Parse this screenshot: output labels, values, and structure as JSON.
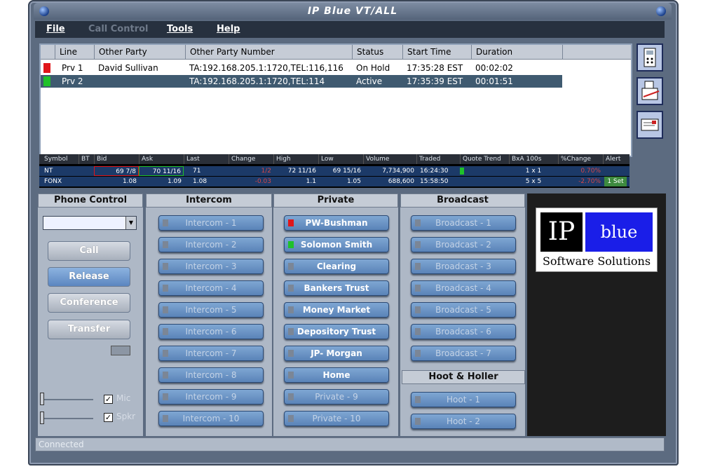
{
  "window": {
    "title": "IP Blue VT/ALL"
  },
  "menu": {
    "file": "File",
    "call_control": "Call Control",
    "tools": "Tools",
    "help": "Help"
  },
  "calls": {
    "headers": [
      "Line",
      "Other Party",
      "Other Party Number",
      "Status",
      "Start Time",
      "Duration"
    ],
    "rows": [
      {
        "line": "Prv 1",
        "party": "David Sullivan",
        "number": "TA:192.168.205.1:1720,TEL:116,116",
        "status": "On Hold",
        "start": "17:35:28 EST",
        "duration": "00:02:02",
        "indicator": "#e0161b"
      },
      {
        "line": "Prv 2",
        "party": "",
        "number": "TA:192.168.205.1:1720,TEL:114",
        "status": "Active",
        "start": "17:35:39 EST",
        "duration": "00:01:51",
        "indicator": "#1fc12a"
      }
    ]
  },
  "quotes": {
    "headers": [
      "Symbol",
      "BT",
      "Bid",
      "Ask",
      "Last",
      "Change",
      "High",
      "Low",
      "Volume",
      "Traded",
      "Quote Trend",
      "BxA 100s",
      "%Change",
      "Alert"
    ],
    "rows": [
      {
        "symbol": "NT",
        "bid": "69 7/8",
        "ask": "70 11/16",
        "last": "71",
        "change": "1/2",
        "high": "72 11/16",
        "low": "69 15/16",
        "volume": "7,734,900",
        "traded": "16:24:30",
        "bxa": "1 x 1",
        "pct": "0.70%",
        "alert": ""
      },
      {
        "symbol": "FONX",
        "bid": "1.08",
        "ask": "1.09",
        "last": "1.08",
        "change": "-0.03",
        "high": "1.1",
        "low": "1.05",
        "volume": "688,600",
        "traded": "15:58:50",
        "bxa": "5 x 5",
        "pct": "-2.70%",
        "alert": "1 Set"
      }
    ]
  },
  "phone_control": {
    "title": "Phone Control",
    "call": "Call",
    "release": "Release",
    "conference": "Conference",
    "transfer": "Transfer",
    "mic": "Mic",
    "spkr": "Spkr"
  },
  "intercom": {
    "title": "Intercom",
    "buttons": [
      "Intercom - 1",
      "Intercom - 2",
      "Intercom - 3",
      "Intercom - 4",
      "Intercom - 5",
      "Intercom - 6",
      "Intercom - 7",
      "Intercom - 8",
      "Intercom - 9",
      "Intercom - 10"
    ]
  },
  "private": {
    "title": "Private",
    "buttons": [
      "PW-Bushman",
      "Solomon Smith",
      "Clearing",
      "Bankers Trust",
      "Money Market",
      "Depository Trust",
      "JP- Morgan",
      "Home",
      "Private - 9",
      "Private - 10"
    ],
    "led_colors": [
      "#e0161b",
      "#1fc12a"
    ]
  },
  "broadcast": {
    "title": "Broadcast",
    "buttons": [
      "Broadcast - 1",
      "Broadcast - 2",
      "Broadcast - 3",
      "Broadcast - 4",
      "Broadcast - 5",
      "Broadcast - 6",
      "Broadcast - 7"
    ]
  },
  "hoot": {
    "title": "Hoot & Holler",
    "buttons": [
      "Hoot - 1",
      "Hoot - 2"
    ]
  },
  "logo": {
    "ip": "IP",
    "blue": "blue",
    "tagline": "Software Solutions"
  },
  "status_bar": {
    "text": "Connected"
  },
  "icons": {
    "side_buttons": [
      "phone-icon",
      "fax-icon",
      "card-icon"
    ]
  }
}
